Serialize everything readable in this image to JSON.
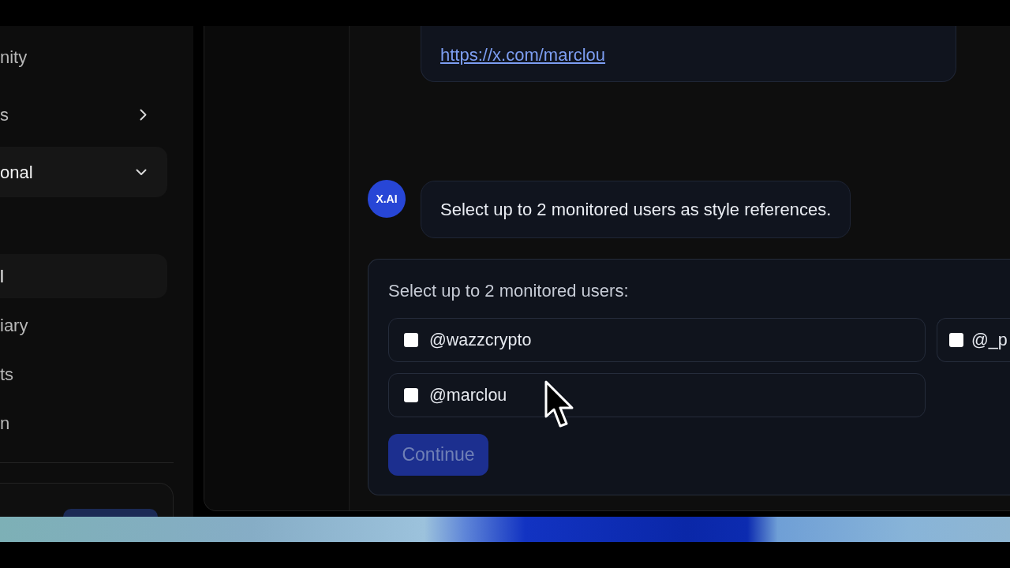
{
  "sidebar": {
    "items": [
      {
        "label": "nity",
        "kind": "link"
      },
      {
        "label": "s",
        "kind": "group",
        "expanded": false
      },
      {
        "label": "onal",
        "kind": "group",
        "expanded": true,
        "children": [
          {
            "label": "l",
            "selected": true
          },
          {
            "label": "iary",
            "selected": false
          },
          {
            "label": "ts",
            "selected": false
          },
          {
            "label": "n",
            "selected": false
          }
        ]
      }
    ]
  },
  "chat": {
    "messages": [
      {
        "kind": "link",
        "text": "https://x.com/marclou"
      },
      {
        "kind": "text",
        "avatar": "X.AI",
        "text": "Select up to 2 monitored users as style references."
      }
    ],
    "picker": {
      "title": "Select up to 2 monitored users:",
      "options": [
        {
          "label": "@wazzcrypto",
          "checked": false
        },
        {
          "label": "@_p",
          "checked": false
        },
        {
          "label": "@marclou",
          "checked": false
        }
      ],
      "continue_button": {
        "label": "Continue",
        "disabled": true
      }
    }
  }
}
